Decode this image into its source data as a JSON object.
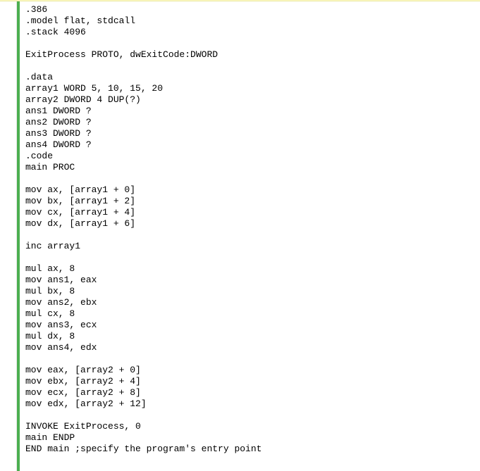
{
  "code": {
    "lines": [
      ".386",
      ".model flat, stdcall",
      ".stack 4096",
      "",
      "ExitProcess PROTO, dwExitCode:DWORD",
      "",
      ".data",
      "array1 WORD 5, 10, 15, 20",
      "array2 DWORD 4 DUP(?)",
      "ans1 DWORD ?",
      "ans2 DWORD ?",
      "ans3 DWORD ?",
      "ans4 DWORD ?",
      ".code",
      "main PROC",
      "",
      "mov ax, [array1 + 0]",
      "mov bx, [array1 + 2]",
      "mov cx, [array1 + 4]",
      "mov dx, [array1 + 6]",
      "",
      "inc array1",
      "",
      "mul ax, 8",
      "mov ans1, eax",
      "mul bx, 8",
      "mov ans2, ebx",
      "mul cx, 8",
      "mov ans3, ecx",
      "mul dx, 8",
      "mov ans4, edx",
      "",
      "mov eax, [array2 + 0]",
      "mov ebx, [array2 + 4]",
      "mov ecx, [array2 + 8]",
      "mov edx, [array2 + 12]",
      "",
      "INVOKE ExitProcess, 0",
      "main ENDP",
      "END main ;specify the program's entry point"
    ],
    "highlighted_line_index": 12
  }
}
